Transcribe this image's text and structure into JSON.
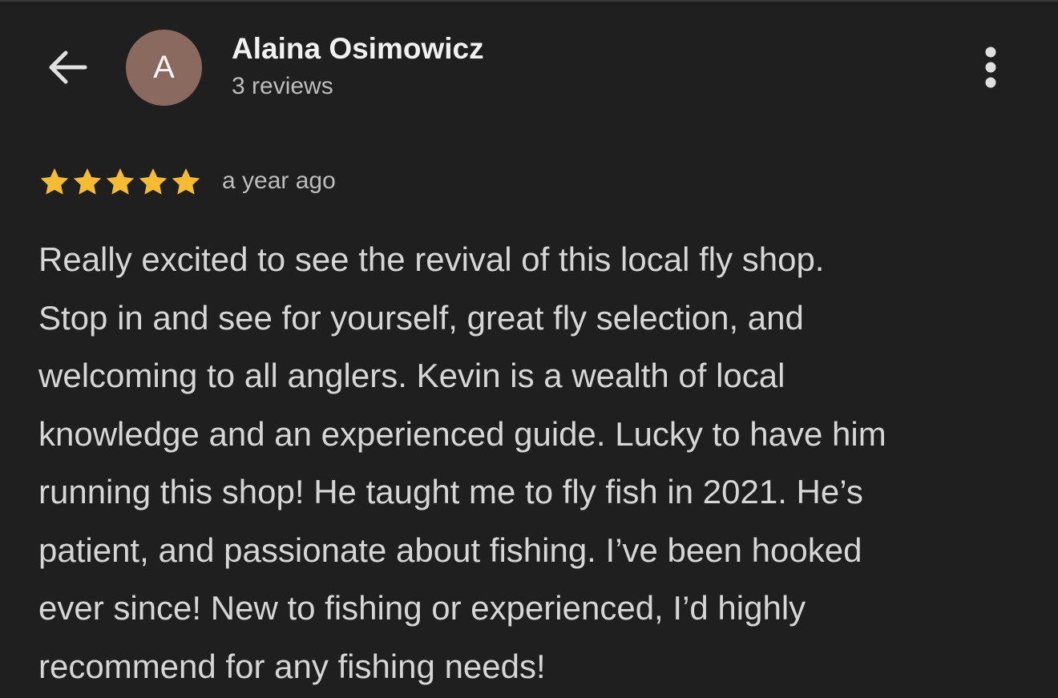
{
  "header": {
    "back_icon": "arrow-left-icon",
    "avatar_letter": "A",
    "avatar_color": "#8a6a5f",
    "reviewer_name": "Alaina Osimowicz",
    "review_count": "3 reviews",
    "more_icon": "more-vertical-icon"
  },
  "review": {
    "rating": 5,
    "max_rating": 5,
    "star_color": "#f4bb33",
    "time": "a year ago",
    "lines": [
      "Really excited to see the revival of this local fly shop.",
      "Stop in and see for yourself, great fly selection, and",
      "welcoming to all anglers. Kevin is a wealth of local",
      "knowledge and an experienced guide. Lucky to have him",
      "running this shop! He taught me to fly fish in 2021. He’s",
      "patient, and passionate about fishing. I’ve been hooked",
      "ever since! New to fishing or experienced, I’d highly",
      "recommend for any fishing needs!"
    ]
  }
}
